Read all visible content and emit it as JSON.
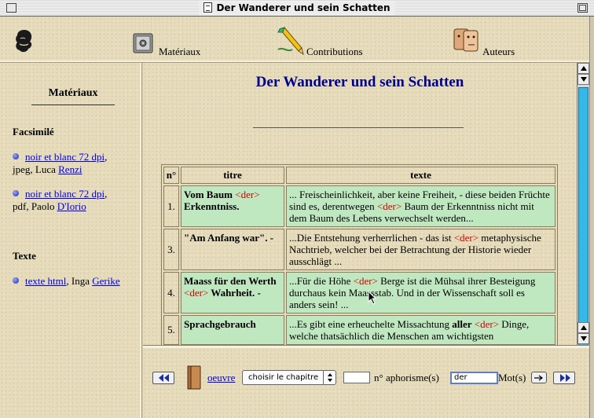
{
  "window": {
    "title": "Der Wanderer und sein Schatten"
  },
  "topnav": {
    "items": [
      {
        "label": "Matériaux",
        "icon": "safe-icon"
      },
      {
        "label": "Contributions",
        "icon": "pencil-icon"
      },
      {
        "label": "Auteurs",
        "icon": "faces-icon"
      }
    ],
    "logo": "nietzsche-portrait-icon"
  },
  "sidebar": {
    "title": "Matériaux",
    "sections": [
      {
        "heading": "Facsimilé",
        "entries": [
          {
            "link": "noir et blanc 72 dpi",
            "sep": ",",
            "text": "jpeg, Luca",
            "person": "Renzi"
          },
          {
            "link": "noir et blanc 72 dpi",
            "sep": ",",
            "text": "pdf, Paolo",
            "person": "D'Iorio"
          }
        ]
      },
      {
        "heading": "Texte",
        "entries": [
          {
            "link": "texte html",
            "sep": ",",
            "text": "Inga",
            "person": "Gerike"
          }
        ]
      }
    ]
  },
  "main": {
    "title": "Der Wanderer und sein Schatten",
    "table": {
      "headers": [
        "n°",
        "titre",
        "texte"
      ],
      "rows": [
        {
          "num": "1.",
          "title_before": "Vom Baum ",
          "title_hl": "<der>",
          "title_after": " Erkenntniss.",
          "text_before": "... Freischeinlichkeit, aber keine Freiheit, - diese beiden Früchte sind es, derentwegen ",
          "text_hl": "<der>",
          "text_after": " Baum der Erkenntniss nicht mit dem Baum des Lebens verwechselt werden...",
          "highlighted": true
        },
        {
          "num": "3.",
          "title_before": "\"Am Anfang war\". -",
          "title_hl": "",
          "title_after": "",
          "text_before": "...Die Entstehung verherrlichen - das ist ",
          "text_hl": "<der>",
          "text_after": " metaphysische Nachtrieb, welcher bei der Betrachtung der Historie wieder ausschlägt ...",
          "highlighted": false
        },
        {
          "num": "4.",
          "title_before": "Maass für den Werth ",
          "title_hl": "<der>",
          "title_after": " Wahrheit. -",
          "text_before": "...Für die Höhe ",
          "text_hl": "<der>",
          "text_after": " Berge ist die Mühsal ihrer Besteigung durchaus kein Maassstab. Und in der Wissenschaft soll es anders sein! ...",
          "highlighted": true
        },
        {
          "num": "5.",
          "title_before": "Sprachgebrauch",
          "title_hl": "",
          "title_after": "",
          "text_before": "...Es gibt eine erheuchelte Missachtung ",
          "text_bold": "aller",
          "text_hl": "<der>",
          "text_after": " Dinge, welche thatsächlich die Menschen am wichtigsten",
          "highlighted": true
        }
      ]
    }
  },
  "bottombar": {
    "oeuvre_label": "oeuvre",
    "chapter_select": "choisir le chapitre",
    "aphorism_value": "",
    "aphorism_label": "n° aphorisme(s)",
    "mot_value": "der",
    "mot_label": "Mot(s)"
  },
  "colors": {
    "title_blue": "#00008b",
    "highlight_red": "#d00000",
    "row_green": "#c0e8c0",
    "scroll_thumb": "#35b8e6"
  }
}
